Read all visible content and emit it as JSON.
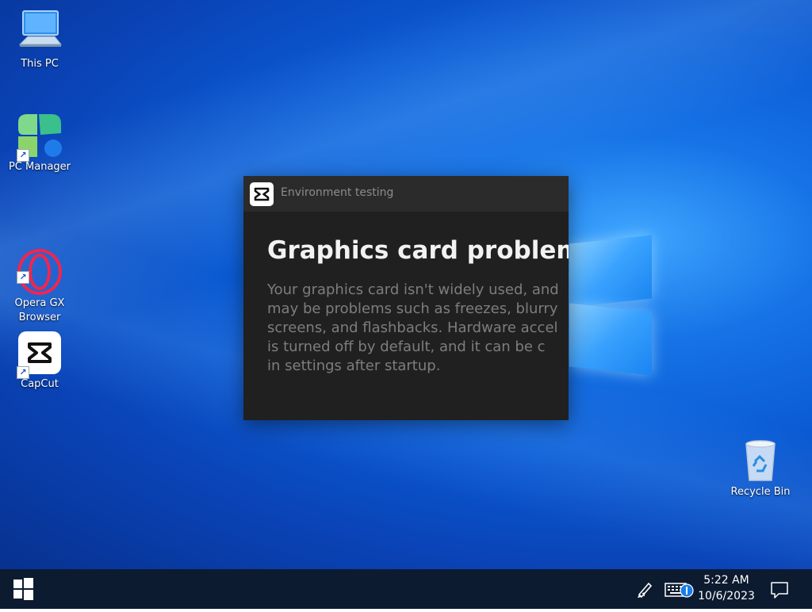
{
  "desktop": {
    "icons": [
      {
        "label": "This PC",
        "icon": "computer-icon",
        "shortcut": false
      },
      {
        "label": "PC Manager",
        "icon": "pc-manager-icon",
        "shortcut": true
      },
      {
        "label": "Opera GX\nBrowser",
        "icon": "opera-gx-icon",
        "shortcut": true
      },
      {
        "label": "CapCut",
        "icon": "capcut-icon",
        "shortcut": true
      },
      {
        "label": "Recycle Bin",
        "icon": "recycle-bin-icon",
        "shortcut": false
      }
    ]
  },
  "dialog": {
    "title": "Environment testing",
    "heading": "Graphics card problem",
    "message": "Your graphics card isn't widely used, and\nmay be problems such as freezes, blurry\nscreens, and flashbacks. Hardware accel\nis turned off by default, and it can be c\nin settings after startup."
  },
  "taskbar": {
    "time": "5:22 AM",
    "date": "10/6/2023",
    "tray_icons": [
      "pen-icon",
      "touch-keyboard-icon",
      "notification-center-icon"
    ]
  },
  "colors": {
    "taskbar": "#0d1b30",
    "dialog_bg": "#202020",
    "dialog_titlebar": "#2b2b2b",
    "accent": "#1a7de6"
  }
}
